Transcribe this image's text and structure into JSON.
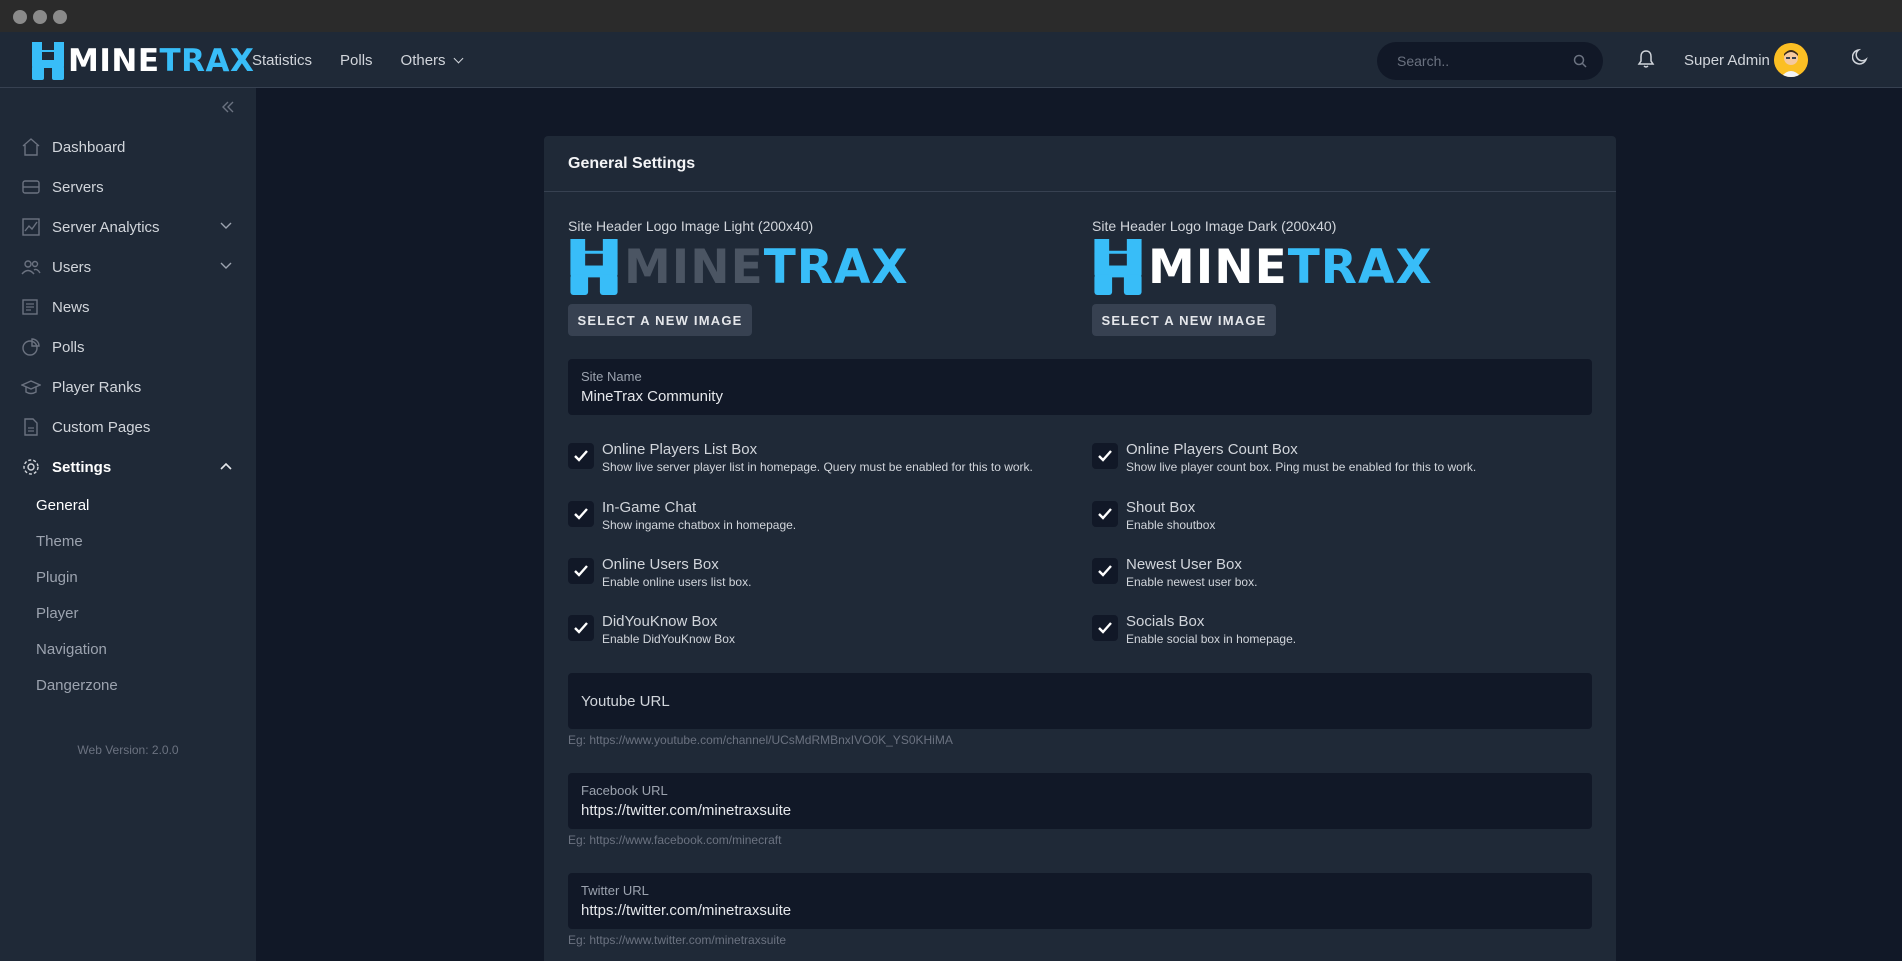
{
  "brand": {
    "mine": "MINE",
    "trax": "TRAX",
    "accent": "#38bdf8"
  },
  "topnav": {
    "links": [
      "Statistics",
      "Polls",
      "Others"
    ],
    "search_placeholder": "Search..",
    "user_name": "Super Admin"
  },
  "sidebar": {
    "items": [
      {
        "label": "Dashboard",
        "icon": "home-icon"
      },
      {
        "label": "Servers",
        "icon": "server-icon"
      },
      {
        "label": "Server Analytics",
        "icon": "chart-icon"
      },
      {
        "label": "Users",
        "icon": "users-icon"
      },
      {
        "label": "News",
        "icon": "newspaper-icon"
      },
      {
        "label": "Polls",
        "icon": "pie-chart-icon"
      },
      {
        "label": "Player Ranks",
        "icon": "graduation-cap-icon"
      },
      {
        "label": "Custom Pages",
        "icon": "document-icon"
      },
      {
        "label": "Settings",
        "icon": "gear-icon"
      }
    ],
    "settings_sub": [
      "General",
      "Theme",
      "Plugin",
      "Player",
      "Navigation",
      "Dangerzone"
    ],
    "version": "Web Version: 2.0.0"
  },
  "card": {
    "title": "General Settings",
    "logo_light_label": "Site Header Logo Image Light (200x40)",
    "logo_dark_label": "Site Header Logo Image Dark (200x40)",
    "select_image_label": "SELECT A NEW IMAGE",
    "site_name_label": "Site Name",
    "site_name_value": "MineTrax Community",
    "checkboxes": [
      {
        "title": "Online Players List Box",
        "desc": "Show live server player list in homepage. Query must be enabled for this to work.",
        "checked": true
      },
      {
        "title": "Online Players Count Box",
        "desc": "Show live player count box. Ping must be enabled for this to work.",
        "checked": true
      },
      {
        "title": "In-Game Chat",
        "desc": "Show ingame chatbox in homepage.",
        "checked": true
      },
      {
        "title": "Shout Box",
        "desc": "Enable shoutbox",
        "checked": true
      },
      {
        "title": "Online Users Box",
        "desc": "Enable online users list box.",
        "checked": true
      },
      {
        "title": "Newest User Box",
        "desc": "Enable newest user box.",
        "checked": true
      },
      {
        "title": "DidYouKnow Box",
        "desc": "Enable DidYouKnow Box",
        "checked": true
      },
      {
        "title": "Socials Box",
        "desc": "Enable social box in homepage.",
        "checked": true
      }
    ],
    "youtube_placeholder": "Youtube URL",
    "youtube_hint": "Eg: https://www.youtube.com/channel/UCsMdRMBnxIVO0K_YS0KHiMA",
    "facebook_label": "Facebook URL",
    "facebook_value": "https://twitter.com/minetraxsuite",
    "facebook_hint": "Eg: https://www.facebook.com/minecraft",
    "twitter_label": "Twitter URL",
    "twitter_value": "https://twitter.com/minetraxsuite",
    "twitter_hint": "Eg: https://www.twitter.com/minetraxsuite"
  }
}
